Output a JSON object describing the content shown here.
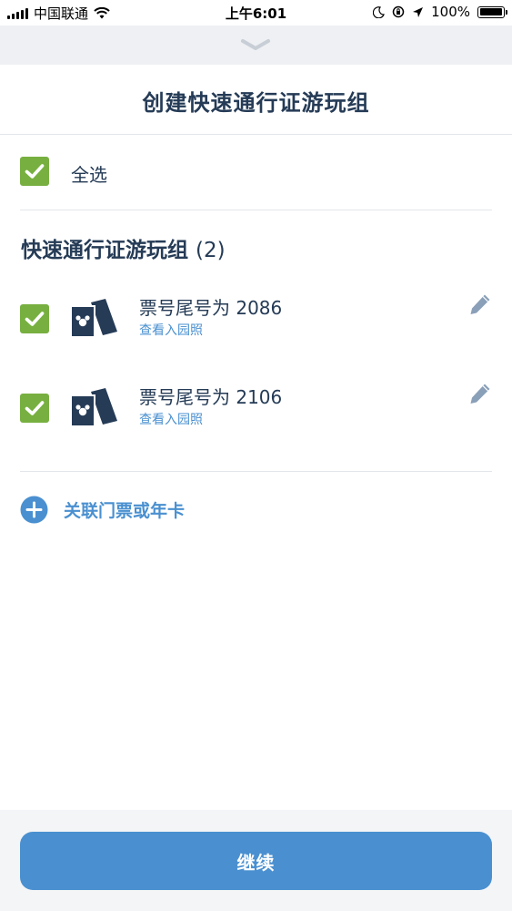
{
  "status_bar": {
    "carrier": "中国联通",
    "time": "上午6:01",
    "battery_text": "100%",
    "battery_level": 1.0
  },
  "header": {
    "title": "创建快速通行证游玩组",
    "collapse_icon": "chevron-down-icon"
  },
  "select_all": {
    "label": "全选",
    "checked": true
  },
  "group": {
    "title": "快速通行证游玩组",
    "count": "(2)",
    "tickets": [
      {
        "title": "票号尾号为 2086",
        "link": "查看入园照",
        "checked": true,
        "icon": "ticket-icon"
      },
      {
        "title": "票号尾号为 2106",
        "link": "查看入园照",
        "checked": true,
        "icon": "ticket-icon"
      }
    ]
  },
  "add_link": {
    "label": "关联门票或年卡",
    "icon": "plus-circle-icon"
  },
  "footer": {
    "continue_label": "继续"
  },
  "colors": {
    "primary": "#4a90d0",
    "checkbox": "#77b040",
    "text": "#253b56",
    "strip": "#eef0f3"
  }
}
